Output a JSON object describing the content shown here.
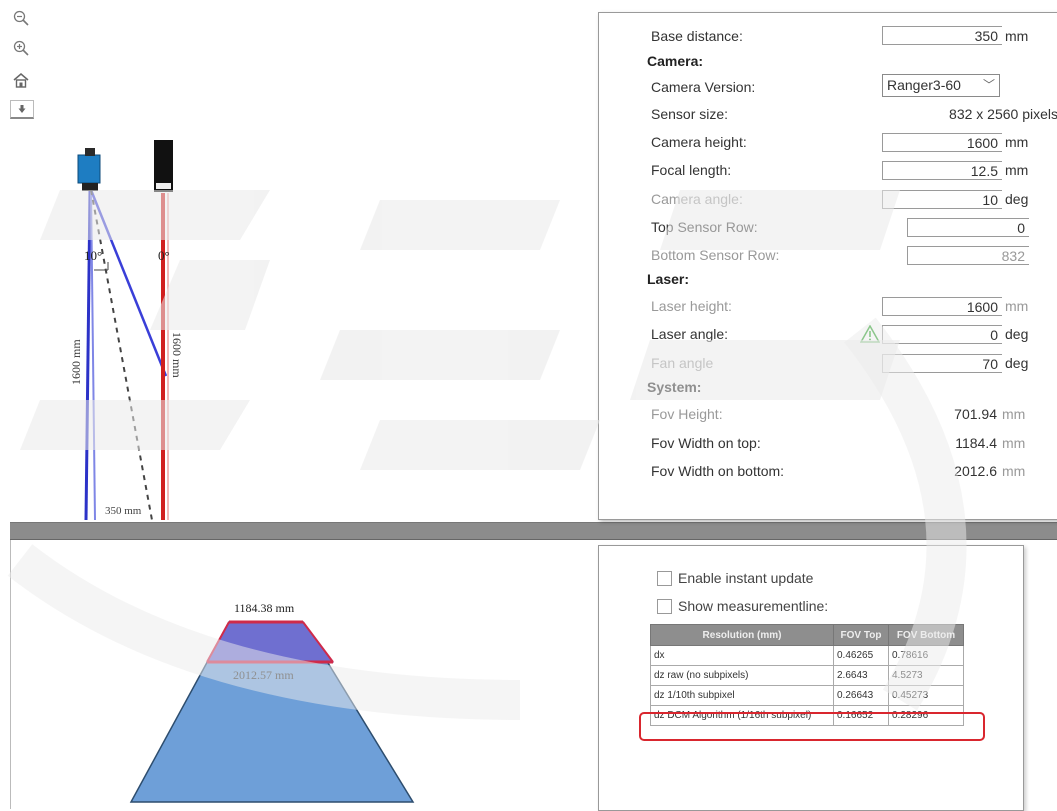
{
  "toolbar": {
    "zoom_out_icon": "zoom-out-icon",
    "zoom_in_icon": "zoom-in-icon",
    "home_icon": "home-icon",
    "pan_icon": "pan-down-icon"
  },
  "scene": {
    "camera_angle_label": "10°",
    "laser_angle_label": "0°",
    "camera_height_label": "1600 mm",
    "laser_height_label": "1600 mm",
    "base_distance_label": "350 mm"
  },
  "params": {
    "base_distance": {
      "label": "Base distance:",
      "value": "350",
      "unit": "mm"
    },
    "camera_section": "Camera:",
    "camera_version": {
      "label": "Camera Version:",
      "value": "Ranger3-60"
    },
    "sensor_size": {
      "label": "Sensor size:",
      "value": "832 x 2560 pixels"
    },
    "camera_height": {
      "label": "Camera height:",
      "value": "1600",
      "unit": "mm"
    },
    "focal_length": {
      "label": "Focal length:",
      "value": "12.5",
      "unit": "mm"
    },
    "camera_angle": {
      "label": "Camera angle:",
      "value": "10",
      "unit": "deg"
    },
    "top_sensor_row": {
      "label": "Top Sensor Row:",
      "value": "0"
    },
    "bottom_sensor_row": {
      "label": "Bottom Sensor Row:",
      "value": "832"
    },
    "laser_section": "Laser:",
    "laser_height": {
      "label": "Laser height:",
      "value": "1600",
      "unit": "mm"
    },
    "laser_angle": {
      "label": "Laser angle:",
      "value": "0",
      "unit": "deg"
    },
    "fan_angle": {
      "label": "Fan angle",
      "value": "70",
      "unit": "deg"
    },
    "system_section": "System:",
    "fov_height": {
      "label": "Fov Height:",
      "value": "701.94",
      "unit": "mm"
    },
    "fov_width_top": {
      "label": "Fov Width on top:",
      "value": "1184.4",
      "unit": "mm"
    },
    "fov_width_bottom": {
      "label": "Fov Width on bottom:",
      "value": "2012.6",
      "unit": "mm"
    }
  },
  "fov_view": {
    "top_width_label": "1184.38 mm",
    "bottom_width_label": "2012.57 mm"
  },
  "resolution": {
    "enable_instant_update": "Enable instant update",
    "show_measurementline": "Show measurementline:",
    "headers": [
      "Resolution (mm)",
      "FOV Top",
      "FOV Bottom"
    ],
    "rows": [
      [
        "dx",
        "0.46265",
        "0.78616"
      ],
      [
        "dz raw (no subpixels)",
        "2.6643",
        "4.5273"
      ],
      [
        "dz 1/10th subpixel",
        "0.26643",
        "0.45273"
      ],
      [
        "dz DCM Algorithm (1/16th subpixel)",
        "0.16652",
        "0.28296"
      ]
    ]
  },
  "colors": {
    "camera_beam": "#3a3fd8",
    "laser_line": "#d11f1f",
    "fov_fill": "#6e9fd8",
    "highlight": "#d9262e"
  }
}
